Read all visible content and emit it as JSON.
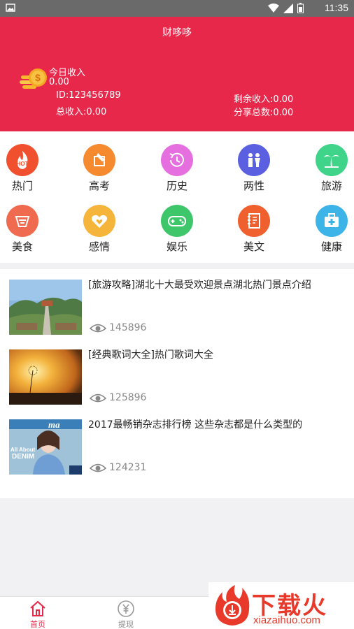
{
  "status_bar": {
    "time": "11:35"
  },
  "header": {
    "title": "财哆哆",
    "today_label": "今日收入",
    "today_value": "0.00",
    "user_id": "ID:123456789",
    "total_income": "总收入:0.00",
    "remaining_income": "剩余收入:0.00",
    "share_total": "分享总数:0.00"
  },
  "categories": [
    {
      "label": "热门",
      "icon": "hot-icon",
      "color": "#f0502e"
    },
    {
      "label": "高考",
      "icon": "exam-pen-icon",
      "color": "#f58a2e"
    },
    {
      "label": "历史",
      "icon": "history-clock-icon",
      "color": "#e66fe0"
    },
    {
      "label": "两性",
      "icon": "gender-icon",
      "color": "#5a60e0"
    },
    {
      "label": "旅游",
      "icon": "palm-tree-icon",
      "color": "#3fd48a"
    },
    {
      "label": "美食",
      "icon": "food-icon",
      "color": "#f06a50"
    },
    {
      "label": "感情",
      "icon": "heart-icon",
      "color": "#f5b43a"
    },
    {
      "label": "娱乐",
      "icon": "gamepad-icon",
      "color": "#3ec76a"
    },
    {
      "label": "美文",
      "icon": "notebook-icon",
      "color": "#f0602e"
    },
    {
      "label": "健康",
      "icon": "medical-kit-icon",
      "color": "#3cb4e8"
    }
  ],
  "articles": [
    {
      "title": "[旅游攻略]湖北十大最受欢迎景点湖北热门景点介绍",
      "views": "145896"
    },
    {
      "title": "[经典歌词大全]热门歌词大全",
      "views": "125896"
    },
    {
      "title": "2017最畅销杂志排行榜 这些杂志都是什么类型的",
      "views": "124231"
    }
  ],
  "magazine_cover": {
    "masthead": "ma",
    "line1": "All About",
    "line2": "DENIM"
  },
  "tabbar": {
    "items": [
      {
        "label": "首页",
        "active": true
      },
      {
        "label": "提现",
        "active": false
      }
    ],
    "active_color": "#e8284a"
  },
  "watermark": {
    "text": "下载火",
    "sub": "xiazaihuo.com"
  }
}
